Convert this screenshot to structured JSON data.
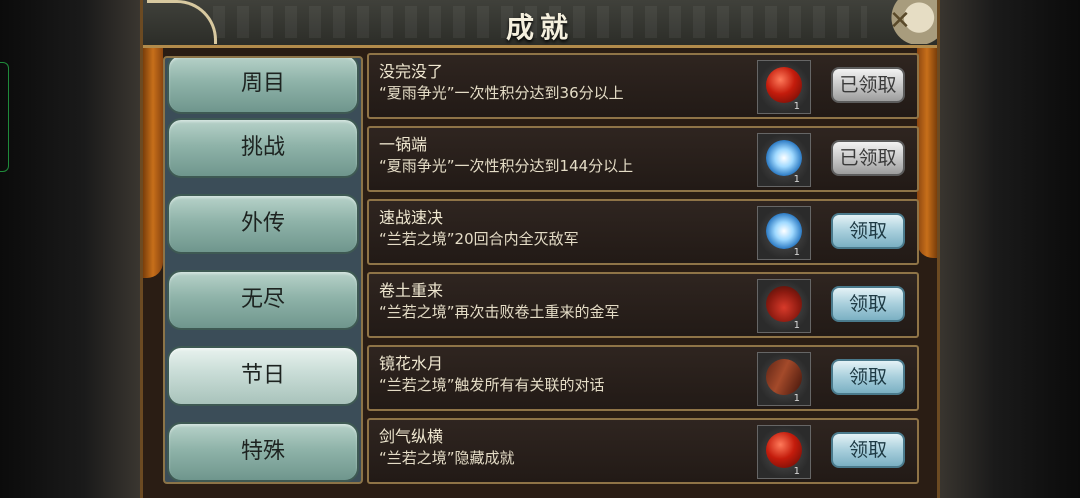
{
  "window": {
    "title": "成就",
    "close_icon": "close-icon"
  },
  "tabs": [
    {
      "label": "周目",
      "active": false
    },
    {
      "label": "挑战",
      "active": false
    },
    {
      "label": "外传",
      "active": false
    },
    {
      "label": "无尽",
      "active": false
    },
    {
      "label": "节日",
      "active": true
    },
    {
      "label": "特殊",
      "active": false
    }
  ],
  "achievements": [
    {
      "title": "没完没了",
      "desc": "“夏雨争光”一次性积分达到36分以上",
      "reward_icon": "ruby-icon",
      "qty": "1",
      "button": "已领取",
      "claimed": true
    },
    {
      "title": "一锅端",
      "desc": "“夏雨争光”一次性积分达到144分以上",
      "reward_icon": "crystal-icon",
      "qty": "1",
      "button": "已领取",
      "claimed": true
    },
    {
      "title": "速战速决",
      "desc": "“兰若之境”20回合内全灭敌军",
      "reward_icon": "crystal-icon",
      "qty": "1",
      "button": "领取",
      "claimed": false
    },
    {
      "title": "卷土重来",
      "desc": "“兰若之境”再次击败卷土重来的金军",
      "reward_icon": "pouch-icon",
      "qty": "1",
      "button": "领取",
      "claimed": false
    },
    {
      "title": "镜花水月",
      "desc": "“兰若之境”触发所有有关联的对话",
      "reward_icon": "scroll-icon",
      "qty": "1",
      "button": "领取",
      "claimed": false
    },
    {
      "title": "剑气纵横",
      "desc": "“兰若之境”隐藏成就",
      "reward_icon": "ruby-icon",
      "qty": "1",
      "button": "领取",
      "claimed": false
    }
  ]
}
